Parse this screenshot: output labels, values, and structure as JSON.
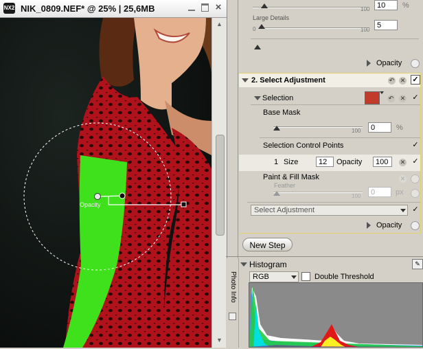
{
  "window": {
    "app_icon_text": "NX2",
    "title": "NIK_0809.NEF* @ 25% | 25,6MB"
  },
  "photo": {
    "control_point_label": "Opacity"
  },
  "panel": {
    "top_sliders": [
      {
        "label": "",
        "value": "10",
        "max_label": "100",
        "unit": "%"
      },
      {
        "label": "Large Details",
        "value": "5",
        "max_label": "100",
        "min_label": "0",
        "unit": ""
      }
    ],
    "step1_opacity_label": "Opacity",
    "step2": {
      "title": "2. Select Adjustment",
      "selection_label": "Selection",
      "base_mask_label": "Base Mask",
      "base_mask_value": "0",
      "base_mask_max": "100",
      "base_mask_unit": "%",
      "control_points_label": "Selection Control Points",
      "cp_row": {
        "index": "1",
        "size_label": "Size",
        "size_value": "12",
        "opacity_label": "Opacity",
        "opacity_value": "100"
      },
      "paint_fill_label": "Paint & Fill Mask",
      "feather_label": "Feather",
      "feather_value": "0",
      "feather_max": "100",
      "feather_unit": "px",
      "adjustment_dropdown": "Select Adjustment",
      "opacity_label": "Opacity"
    },
    "new_step_label": "New Step",
    "histogram": {
      "side_tab_label": "Photo Info",
      "title": "Histogram",
      "channel": "RGB",
      "double_threshold_label": "Double Threshold"
    }
  }
}
